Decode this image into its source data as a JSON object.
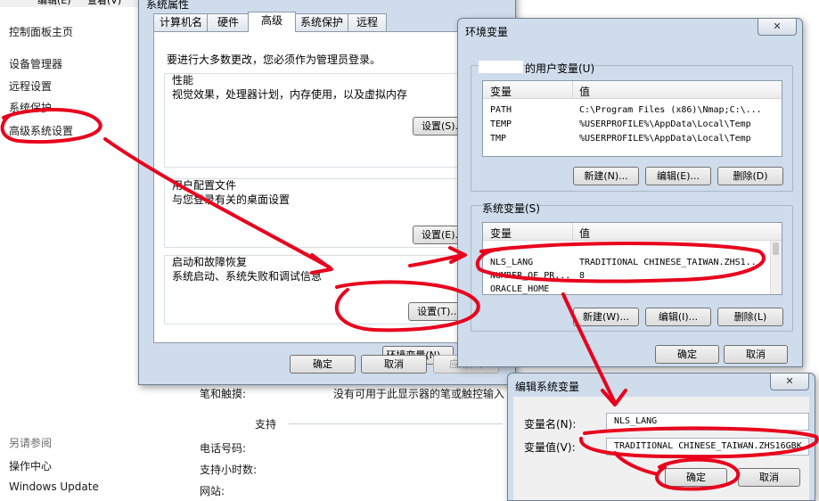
{
  "top_menu": {
    "edit": "编辑(E)",
    "view": "查看(V)"
  },
  "left_pane": {
    "home": "控制面板主页",
    "items": [
      "设备管理器",
      "远程设置",
      "系统保护",
      "高级系统设置"
    ],
    "see_also_title": "另请参阅",
    "see_also": [
      "操作中心",
      "Windows Update"
    ]
  },
  "background_info": {
    "pen_touch_label": "笔和触摸:",
    "pen_touch_value": "没有可用于此显示器的笔或触控输入",
    "support_title": "支持",
    "phone_label": "电话号码:",
    "hours_label": "支持小时数:",
    "website_label": "网站:"
  },
  "sys_props": {
    "title": "系统属性",
    "tabs": [
      "计算机名",
      "硬件",
      "高级",
      "系统保护",
      "远程"
    ],
    "active_tab": "高级",
    "admin_note": "要进行大多数更改，您必须作为管理员登录。",
    "perf_title": "性能",
    "perf_desc": "视觉效果，处理器计划，内存使用，以及虚拟内存",
    "settings_btn": "设置(S)...",
    "profile_title": "用户配置文件",
    "profile_desc": "与您登录有关的桌面设置",
    "profile_btn": "设置(E)...",
    "startup_title": "启动和故障恢复",
    "startup_desc": "系统启动、系统失败和调试信息",
    "startup_btn": "设置(T)...",
    "env_btn": "环境变量(N)...",
    "ok": "确定",
    "cancel": "取消",
    "apply": "应用(A)"
  },
  "env_vars": {
    "title": "环境变量",
    "user_group": "的用户变量(U)",
    "col_var": "变量",
    "col_val": "值",
    "user_rows": [
      {
        "var": "PATH",
        "val": "C:\\Program Files (x86)\\Nmap;C:\\..."
      },
      {
        "var": "TEMP",
        "val": "%USERPROFILE%\\AppData\\Local\\Temp"
      },
      {
        "var": "TMP",
        "val": "%USERPROFILE%\\AppData\\Local\\Temp"
      }
    ],
    "new_btn": "新建(N)...",
    "edit_btn": "编辑(E)...",
    "delete_btn": "删除(D)",
    "sys_group": "系统变量(S)",
    "sys_rows": [
      {
        "var": "NLS_LANG",
        "val": "TRADITIONAL CHINESE_TAIWAN.ZHS1..."
      },
      {
        "var": "NUMBER_OF_PR...",
        "val": "8"
      },
      {
        "var": "ORACLE_HOME",
        "val": ""
      }
    ],
    "sys_new_btn": "新建(W)...",
    "sys_edit_btn": "编辑(I)...",
    "sys_delete_btn": "删除(L)",
    "ok": "确定",
    "cancel": "取消"
  },
  "edit_sys_var": {
    "title": "编辑系统变量",
    "name_label": "变量名(N):",
    "name_value": "NLS_LANG",
    "value_label": "变量值(V):",
    "value_value": "TRADITIONAL CHINESE_TAIWAN.ZHS16GBK",
    "ok": "确定",
    "cancel": "取消"
  },
  "colors": {
    "annotation": "#e8001c",
    "window_frame": "#cfdcec"
  }
}
